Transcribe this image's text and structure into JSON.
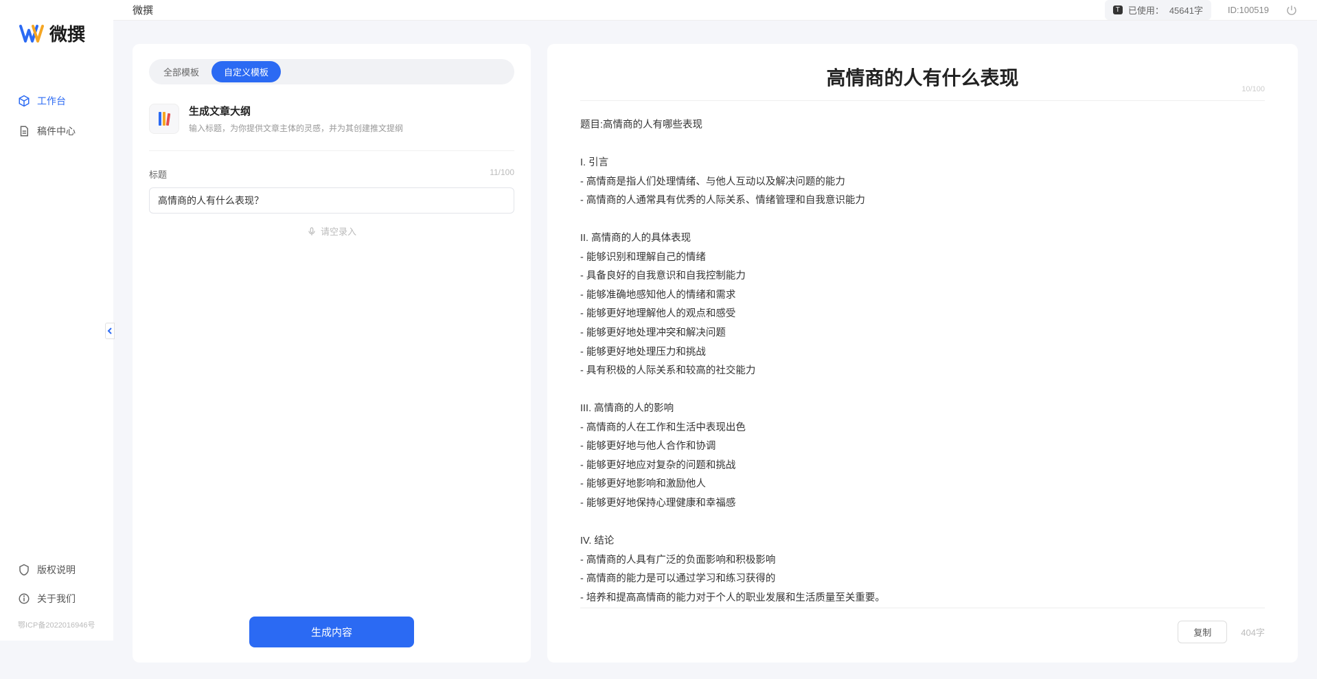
{
  "app": {
    "brand": "微撰",
    "title": "微撰"
  },
  "sidebar": {
    "items": [
      {
        "label": "工作台",
        "icon": "cube"
      },
      {
        "label": "稿件中心",
        "icon": "doc"
      }
    ],
    "footer": [
      {
        "label": "版权说明",
        "icon": "shield"
      },
      {
        "label": "关于我们",
        "icon": "info"
      }
    ],
    "icp": "鄂ICP备2022016946号"
  },
  "topbar": {
    "usage_label": "已使用：",
    "usage_value": "45641字",
    "usage_badge": "T",
    "userid_label": "ID:",
    "userid_value": "100519"
  },
  "left": {
    "tabs": [
      {
        "label": "全部模板",
        "active": false
      },
      {
        "label": "自定义模板",
        "active": true
      }
    ],
    "template": {
      "title": "生成文章大纲",
      "desc": "输入标题，为你提供文章主体的灵感，并为其创建推文提纲"
    },
    "field_label": "标题",
    "field_count": "11/100",
    "field_value": "高情商的人有什么表现？",
    "voice_label": "请空录入",
    "generate_label": "生成内容"
  },
  "right": {
    "title": "高情商的人有什么表现",
    "title_count": "10/100",
    "body": "题目:高情商的人有哪些表现\n\nI. 引言\n- 高情商是指人们处理情绪、与他人互动以及解决问题的能力\n- 高情商的人通常具有优秀的人际关系、情绪管理和自我意识能力\n\nII. 高情商的人的具体表现\n- 能够识别和理解自己的情绪\n- 具备良好的自我意识和自我控制能力\n- 能够准确地感知他人的情绪和需求\n- 能够更好地理解他人的观点和感受\n- 能够更好地处理冲突和解决问题\n- 能够更好地处理压力和挑战\n- 具有积极的人际关系和较高的社交能力\n\nIII. 高情商的人的影响\n- 高情商的人在工作和生活中表现出色\n- 能够更好地与他人合作和协调\n- 能够更好地应对复杂的问题和挑战\n- 能够更好地影响和激励他人\n- 能够更好地保持心理健康和幸福感\n\nIV. 结论\n- 高情商的人具有广泛的负面影响和积极影响\n- 高情商的能力是可以通过学习和练习获得的\n- 培养和提高高情商的能力对于个人的职业发展和生活质量至关重要。",
    "copy_label": "复制",
    "char_count": "404字"
  }
}
